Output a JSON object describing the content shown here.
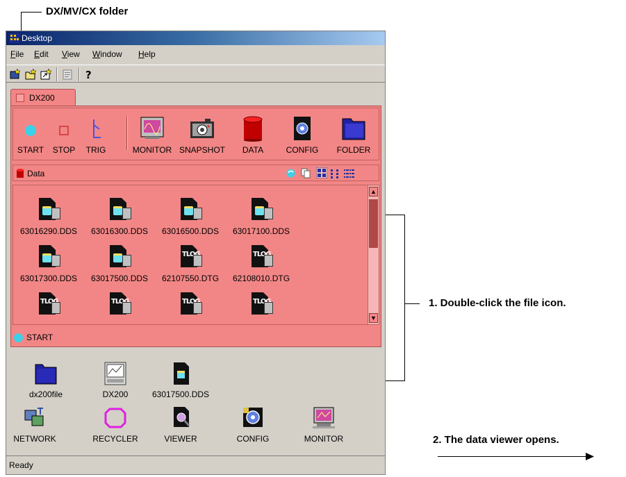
{
  "callouts": {
    "folder_label": "DX/MV/CX folder",
    "step1": "1. Double-click the file icon.",
    "step2": "2. The data viewer opens."
  },
  "window": {
    "title": "Desktop",
    "menu": [
      {
        "label": "File",
        "mnemonic": "F"
      },
      {
        "label": "Edit",
        "mnemonic": "E"
      },
      {
        "label": "View",
        "mnemonic": "V"
      },
      {
        "label": "Window",
        "mnemonic": "W"
      },
      {
        "label": "Help",
        "mnemonic": "H"
      }
    ],
    "toolbar_icons": [
      "new-icon",
      "open-folder-icon",
      "shortcut-icon",
      "properties-icon",
      "help-icon"
    ],
    "status": "Ready"
  },
  "folder": {
    "tab_label": "DX200",
    "commands": [
      "START",
      "STOP",
      "TRIG",
      "MONITOR",
      "SNAPSHOT",
      "DATA",
      "CONFIG",
      "FOLDER"
    ],
    "data_header": "Data",
    "files": [
      {
        "name": "63016290.DDS",
        "type": "dds"
      },
      {
        "name": "63016300.DDS",
        "type": "dds"
      },
      {
        "name": "63016500.DDS",
        "type": "dds"
      },
      {
        "name": "63017100.DDS",
        "type": "dds"
      },
      {
        "name": "63017300.DDS",
        "type": "dds"
      },
      {
        "name": "63017500.DDS",
        "type": "dds"
      },
      {
        "name": "62107550.DTG",
        "type": "dtg"
      },
      {
        "name": "62108010.DTG",
        "type": "dtg"
      },
      {
        "name": "",
        "type": "dtg"
      },
      {
        "name": "",
        "type": "dtg"
      },
      {
        "name": "",
        "type": "dtg"
      },
      {
        "name": "",
        "type": "dtg"
      }
    ],
    "status": "START",
    "status_color": "#3cd0e8",
    "panel_color": "#f28686"
  },
  "desktop_icons": [
    {
      "label": "dx200file",
      "icon": "folder-icon"
    },
    {
      "label": "DX200",
      "icon": "recorder-icon"
    },
    {
      "label": "63017500.DDS",
      "icon": "dds-file-icon"
    },
    {
      "label": "NETWORK",
      "icon": "network-icon"
    },
    {
      "label": "RECYCLER",
      "icon": "recycler-icon"
    },
    {
      "label": "VIEWER",
      "icon": "viewer-icon"
    },
    {
      "label": "CONFIG",
      "icon": "config-icon"
    },
    {
      "label": "MONITOR",
      "icon": "monitor-icon"
    }
  ]
}
